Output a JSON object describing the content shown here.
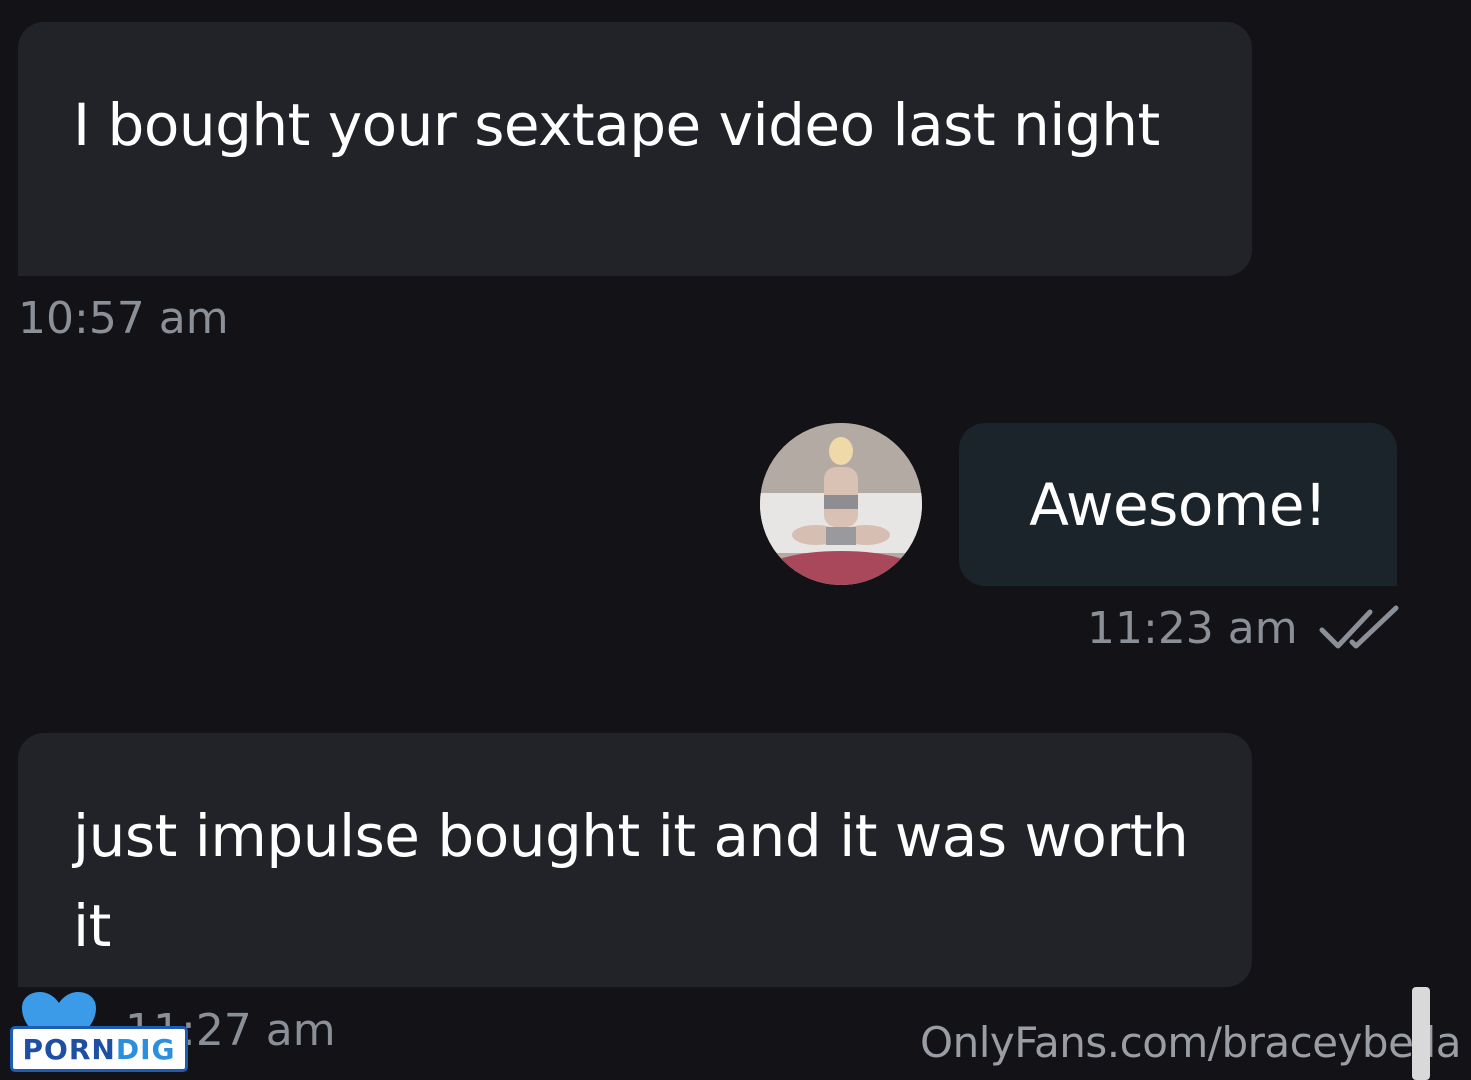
{
  "messages": [
    {
      "text": "I bought your sextape video last night",
      "time": "10:57 am"
    },
    {
      "text": "Awesome!",
      "time": "11:23 am"
    },
    {
      "text": "just impulse bought it and it was worth it",
      "time": "11:27 am"
    }
  ],
  "watermark": "OnlyFans.com/braceybella",
  "logo": {
    "part1": "PORN",
    "part2": "DIG"
  },
  "colors": {
    "background": "#131317",
    "incoming_bubble": "#222328",
    "outgoing_bubble": "#1b232b",
    "timestamp": "#8a8f98",
    "read_check": "#8a8f98",
    "heart": "#3c9be8"
  },
  "icons": {
    "read_status": "double-check-icon",
    "reaction": "heart-icon"
  }
}
